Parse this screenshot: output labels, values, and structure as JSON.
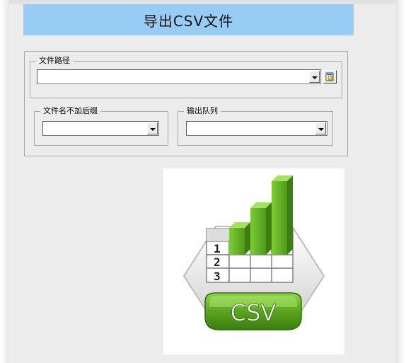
{
  "title": "导出CSV文件",
  "file_path_group": {
    "label": "文件路径",
    "value": ""
  },
  "file_name_group": {
    "label": "文件名不加后缀",
    "value": ""
  },
  "output_queue_group": {
    "label": "输出队列",
    "value": ""
  },
  "logo": {
    "text": "CSV",
    "row_numbers": [
      "1",
      "2",
      "3"
    ]
  },
  "colors": {
    "title_bar": "#97cdf5",
    "panel": "#ececec",
    "logo_green": "#6ab82a"
  }
}
